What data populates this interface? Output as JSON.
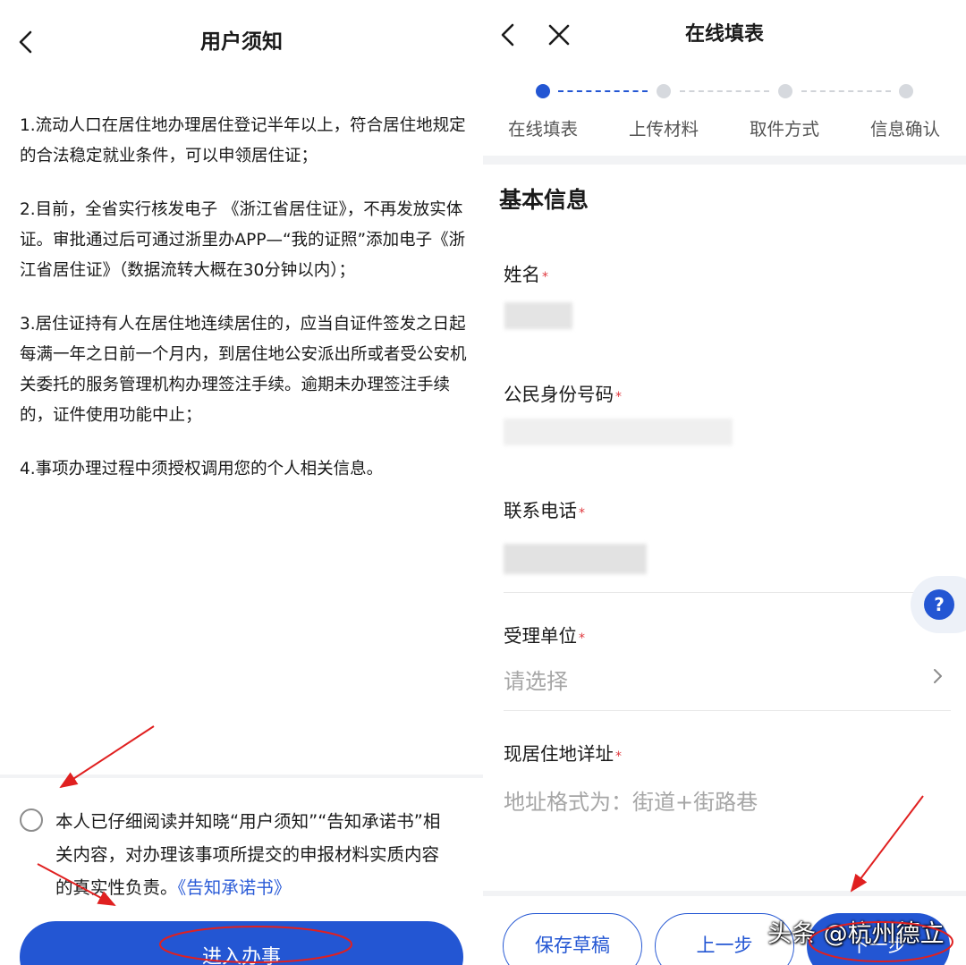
{
  "left": {
    "title": "用户须知",
    "notices": [
      "1.流动人口在居住地办理居住登记半年以上，符合居住地规定的合法稳定就业条件，可以申领居住证；",
      "2.目前，全省实行核发电子 《浙江省居住证》，不再发放实体证。审批通过后可通过浙里办APP—“我的证照”添加电子《浙江省居住证》（数据流转大概在30分钟以内）；",
      "3.居住证持有人在居住地连续居住的，应当自证件签发之日起每满一年之日前一个月内，到居住地公安派出所或者受公安机关委托的服务管理机构办理签注手续。逾期未办理签注手续的，证件使用功能中止；",
      "4.事项办理过程中须授权调用您的个人相关信息。"
    ],
    "consent_text": "本人已仔细阅读并知晓“用户须知”“告知承诺书”相关内容，对办理该事项所提交的申报材料实质内容的真实性负责。",
    "consent_link": "《告知承诺书》",
    "enter_button": "进入办事"
  },
  "right": {
    "title": "在线填表",
    "steps": [
      "在线填表",
      "上传材料",
      "取件方式",
      "信息确认"
    ],
    "active_step": 0,
    "section_title": "基本信息",
    "required_mark": "*",
    "fields": {
      "name_label": "姓名",
      "id_label": "公民身份号码",
      "phone_label": "联系电话",
      "unit_label": "受理单位",
      "unit_placeholder": "请选择",
      "address_label": "现居住地详址",
      "address_placeholder": "地址格式为：街道+街路巷"
    },
    "help": "?",
    "buttons": {
      "save": "保存草稿",
      "prev": "上一步",
      "next": "下一步"
    },
    "watermark": "头条 @杭州德立"
  },
  "colors": {
    "primary": "#2356d3",
    "required": "#e0383e",
    "annotation": "#e02020"
  }
}
